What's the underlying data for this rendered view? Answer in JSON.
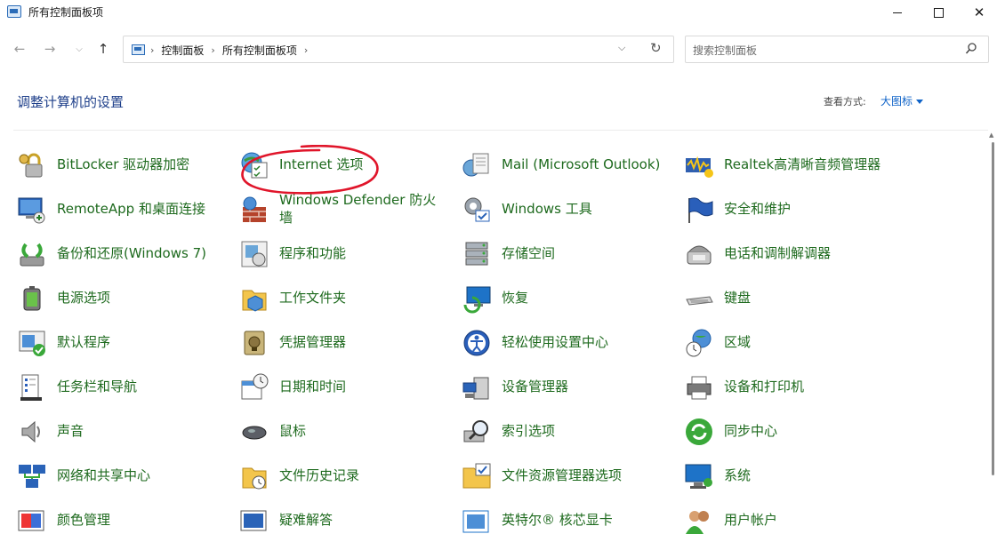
{
  "window": {
    "title": "所有控制面板项"
  },
  "address": {
    "crumbs": [
      "控制面板",
      "所有控制面板项"
    ]
  },
  "search": {
    "placeholder": "搜索控制面板"
  },
  "header": {
    "title": "调整计算机的设置",
    "view_by_label": "查看方式:",
    "view_by_value": "大图标"
  },
  "colors": {
    "item_text": "#1e6a1e",
    "heading": "#1e3f8a",
    "link": "#0f63c8",
    "annotation": "#e0152a"
  },
  "items": [
    {
      "label": "BitLocker 驱动器加密",
      "icon": "bitlocker-icon"
    },
    {
      "label": "Internet 选项",
      "icon": "internet-options-icon"
    },
    {
      "label": "Mail (Microsoft Outlook)",
      "icon": "mail-icon"
    },
    {
      "label": "Realtek高清晰音频管理器",
      "icon": "realtek-audio-icon"
    },
    {
      "label": "RemoteApp 和桌面连接",
      "icon": "remoteapp-icon"
    },
    {
      "label": "Windows Defender 防火墙",
      "icon": "firewall-icon"
    },
    {
      "label": "Windows 工具",
      "icon": "windows-tools-icon"
    },
    {
      "label": "安全和维护",
      "icon": "security-flag-icon"
    },
    {
      "label": "备份和还原(Windows 7)",
      "icon": "backup-icon"
    },
    {
      "label": "程序和功能",
      "icon": "programs-icon"
    },
    {
      "label": "存储空间",
      "icon": "storage-icon"
    },
    {
      "label": "电话和调制解调器",
      "icon": "phone-modem-icon"
    },
    {
      "label": "电源选项",
      "icon": "power-icon"
    },
    {
      "label": "工作文件夹",
      "icon": "work-folders-icon"
    },
    {
      "label": "恢复",
      "icon": "recovery-icon"
    },
    {
      "label": "键盘",
      "icon": "keyboard-icon"
    },
    {
      "label": "默认程序",
      "icon": "default-programs-icon"
    },
    {
      "label": "凭据管理器",
      "icon": "credential-icon"
    },
    {
      "label": "轻松使用设置中心",
      "icon": "ease-of-access-icon"
    },
    {
      "label": "区域",
      "icon": "region-icon"
    },
    {
      "label": "任务栏和导航",
      "icon": "taskbar-icon"
    },
    {
      "label": "日期和时间",
      "icon": "datetime-icon"
    },
    {
      "label": "设备管理器",
      "icon": "device-manager-icon"
    },
    {
      "label": "设备和打印机",
      "icon": "printer-icon"
    },
    {
      "label": "声音",
      "icon": "sound-icon"
    },
    {
      "label": "鼠标",
      "icon": "mouse-icon"
    },
    {
      "label": "索引选项",
      "icon": "indexing-icon"
    },
    {
      "label": "同步中心",
      "icon": "sync-icon"
    },
    {
      "label": "网络和共享中心",
      "icon": "network-icon"
    },
    {
      "label": "文件历史记录",
      "icon": "file-history-icon"
    },
    {
      "label": "文件资源管理器选项",
      "icon": "explorer-options-icon"
    },
    {
      "label": "系统",
      "icon": "system-icon"
    },
    {
      "label": "颜色管理",
      "icon": "color-management-icon"
    },
    {
      "label": "疑难解答",
      "icon": "troubleshooting-icon"
    },
    {
      "label": "英特尔® 核芯显卡",
      "icon": "intel-graphics-icon"
    },
    {
      "label": "用户帐户",
      "icon": "user-accounts-icon"
    }
  ]
}
